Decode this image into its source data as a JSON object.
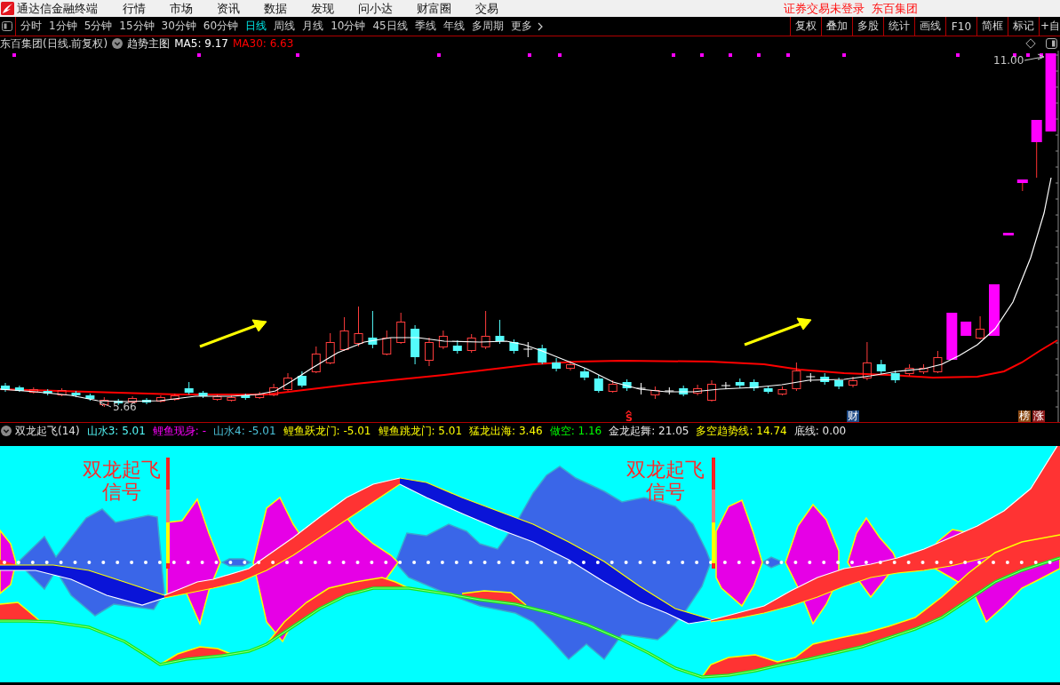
{
  "title_bar": {
    "app_name": "通达信金融终端",
    "menu": [
      "行情",
      "市场",
      "资讯",
      "数据",
      "发现",
      "问小达",
      "财富圈",
      "交易"
    ],
    "login_status": "证券交易未登录",
    "stock_name": "东百集团"
  },
  "period_bar": {
    "periods": [
      {
        "label": "分时",
        "selected": false
      },
      {
        "label": "1分钟",
        "selected": false
      },
      {
        "label": "5分钟",
        "selected": false
      },
      {
        "label": "15分钟",
        "selected": false
      },
      {
        "label": "30分钟",
        "selected": false
      },
      {
        "label": "60分钟",
        "selected": false
      },
      {
        "label": "日线",
        "selected": true
      },
      {
        "label": "周线",
        "selected": false
      },
      {
        "label": "月线",
        "selected": false
      },
      {
        "label": "10分钟",
        "selected": false
      },
      {
        "label": "45日线",
        "selected": false
      },
      {
        "label": "季线",
        "selected": false
      },
      {
        "label": "年线",
        "selected": false
      },
      {
        "label": "多周期",
        "selected": false
      }
    ],
    "more": "更多",
    "tools": [
      "复权",
      "叠加",
      "多股",
      "统计",
      "画线",
      "F10",
      "简框",
      "标记",
      "+自"
    ]
  },
  "main_chart": {
    "title": "东百集团(日线.前复权)",
    "template": "趋势主图",
    "indicators": [
      {
        "label": "MA5: 9.17",
        "color": "#ffffff"
      },
      {
        "label": "MA30: 6.63",
        "color": "#ff0000"
      }
    ],
    "high_label": "11.00",
    "low_label": "5.66",
    "markers": [
      {
        "kind": "signal",
        "text": "S"
      },
      {
        "kind": "badge",
        "text": "财",
        "color": "#1e4a86"
      },
      {
        "kind": "badge",
        "text": "榜",
        "color": "#8b4a14"
      },
      {
        "kind": "badge",
        "text": "涨",
        "color": "#8c1c1c"
      }
    ]
  },
  "indicator_panel": {
    "name": "双龙起飞(14)",
    "values": [
      {
        "label": "山水3: 5.01",
        "color": "#54fcfc"
      },
      {
        "label": "鲤鱼现身: -",
        "color": "#ff00ff"
      },
      {
        "label": "山水4: -5.01",
        "color": "#4cc4dc"
      },
      {
        "label": "鲤鱼跃龙门: -5.01",
        "color": "#ffff00"
      },
      {
        "label": "鲤鱼跳龙门: 5.01",
        "color": "#ffff00"
      },
      {
        "label": "猛龙出海: 3.46",
        "color": "#ffff00"
      },
      {
        "label": "做空: 1.16",
        "color": "#00ff00"
      },
      {
        "label": "金龙起舞: 21.05",
        "color": "#e8e8e8"
      },
      {
        "label": "多空趋势线: 14.74",
        "color": "#ffff00"
      },
      {
        "label": "底线: 0.00",
        "color": "#e8e8e8"
      }
    ],
    "signal_labels": [
      {
        "title": "双龙起飞",
        "subtitle": "信号"
      },
      {
        "title": "双龙起飞",
        "subtitle": "信号"
      }
    ]
  }
}
